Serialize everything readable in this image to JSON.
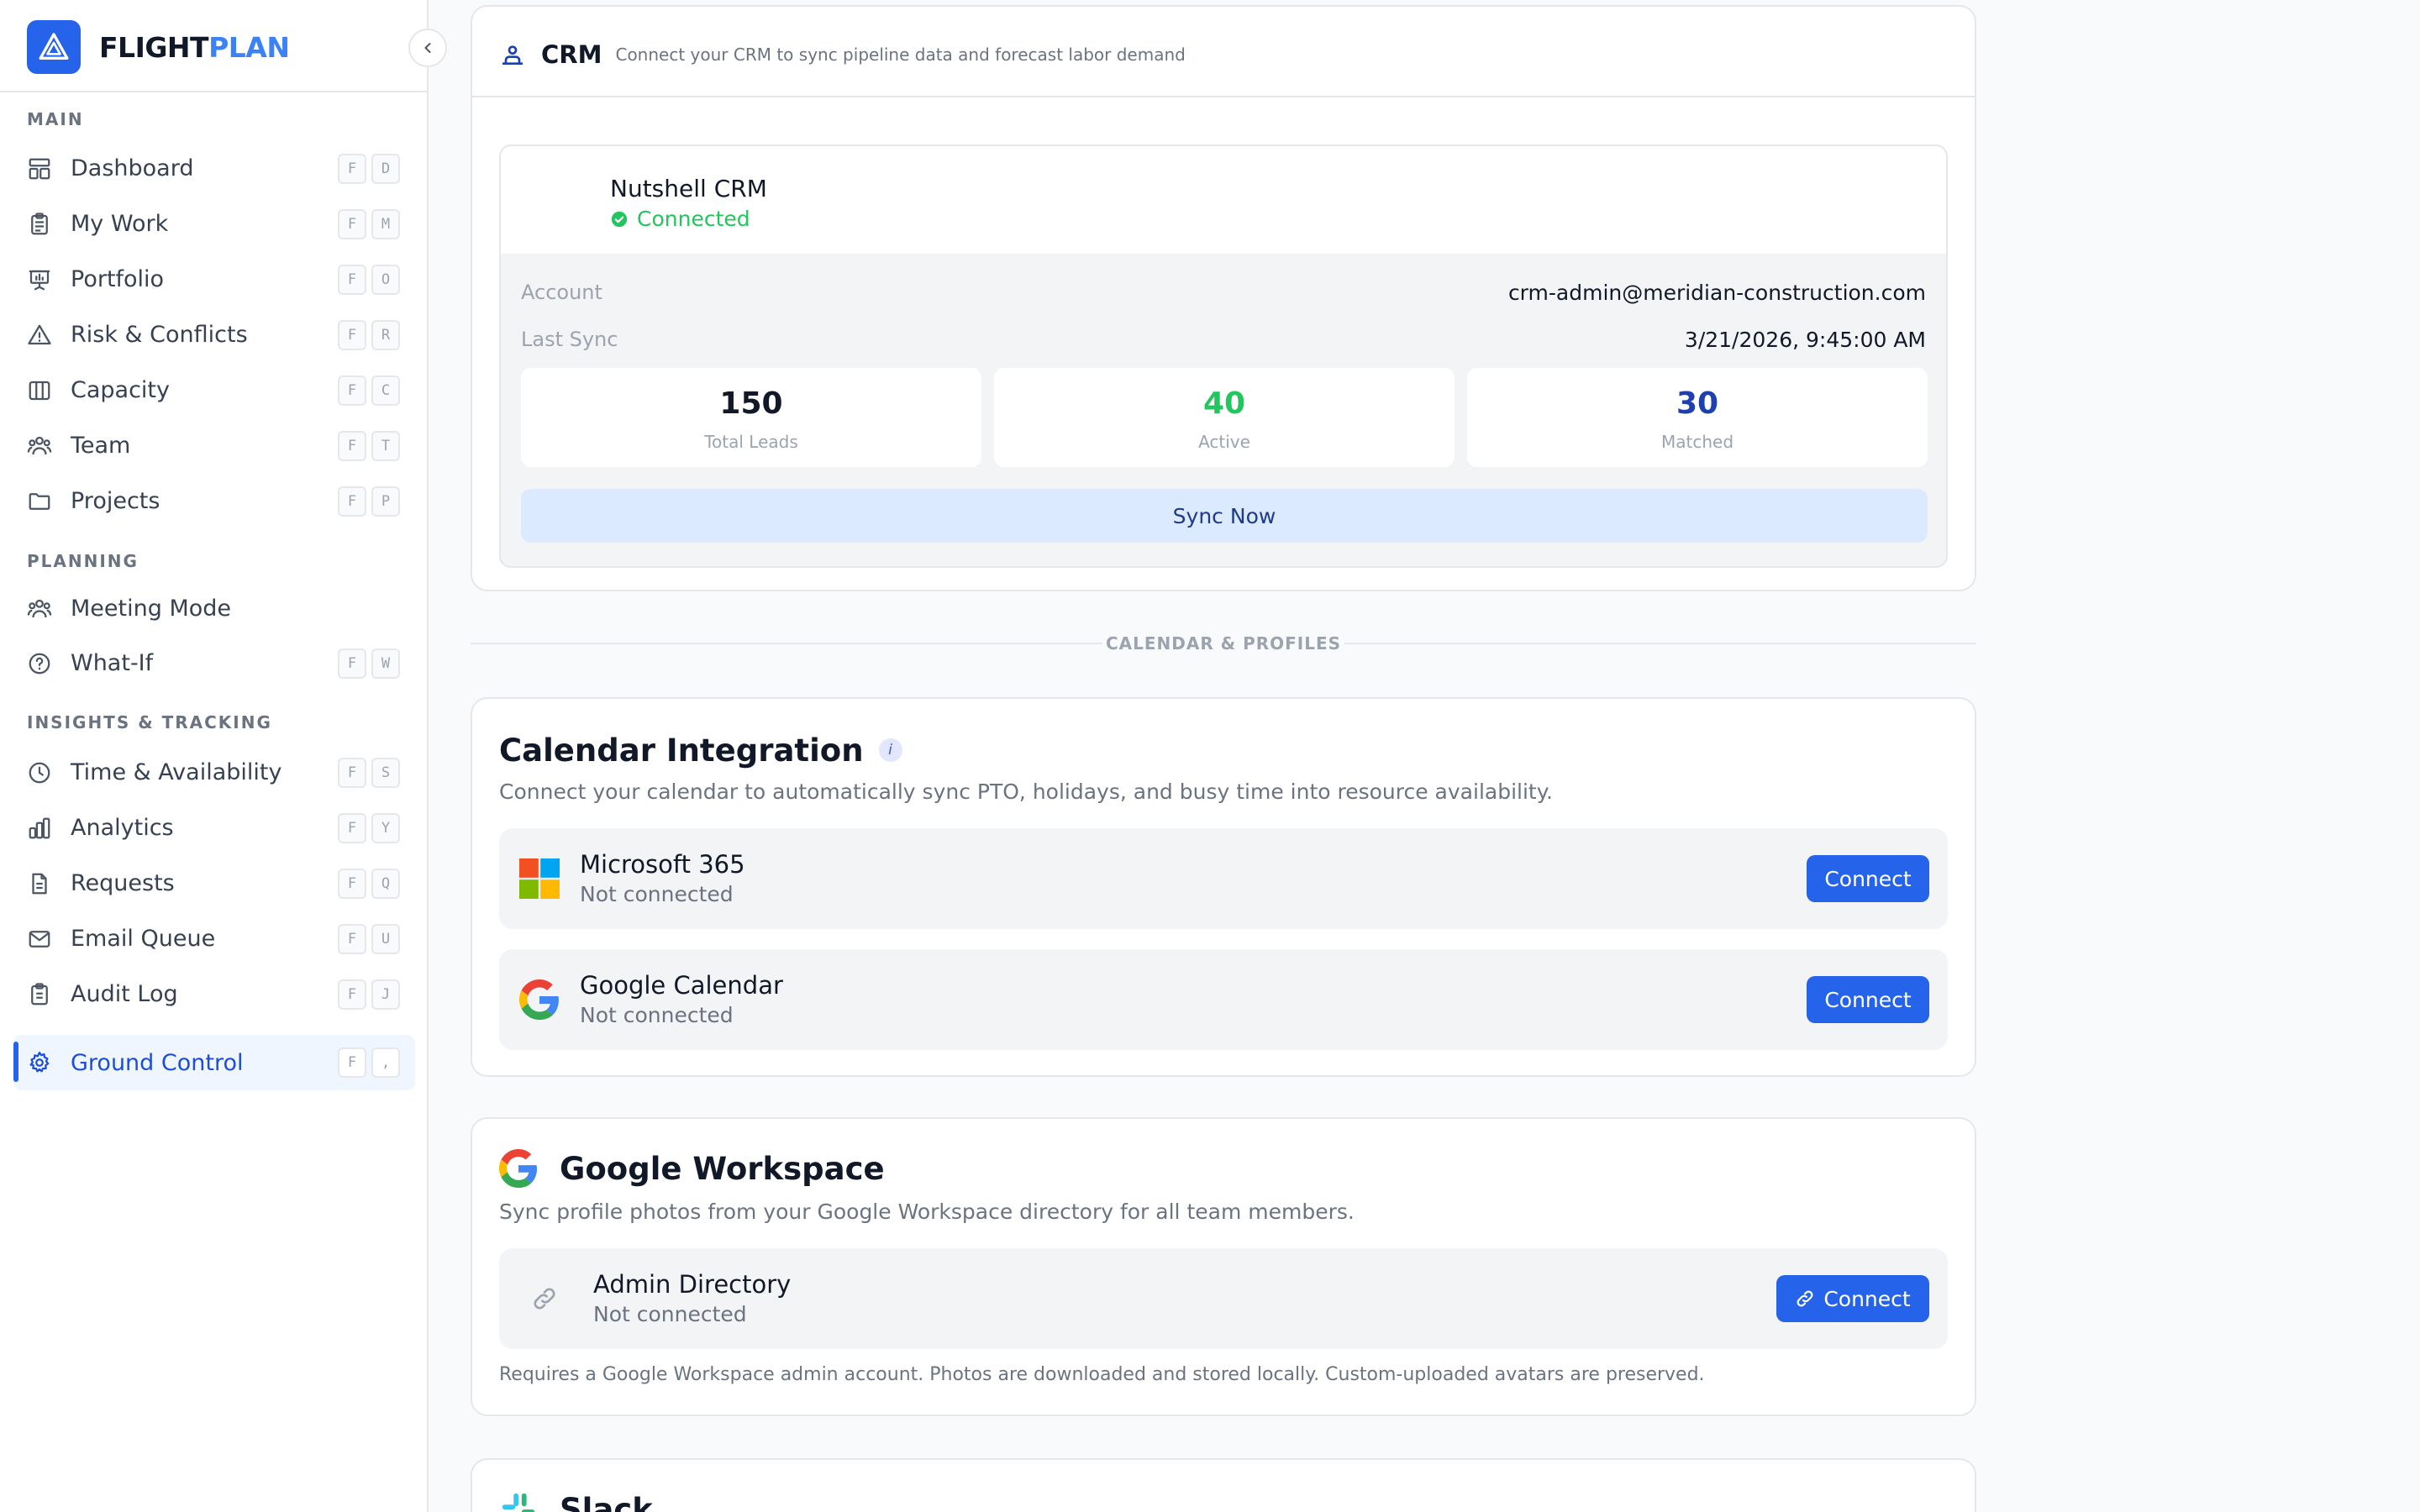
{
  "brand": {
    "part1": "FLIGHT",
    "part2": "PLAN"
  },
  "nav": {
    "main_label": "MAIN",
    "planning_label": "PLANNING",
    "insights_label": "INSIGHTS & TRACKING",
    "items": [
      {
        "label": "Dashboard",
        "k1": "F",
        "k2": "D"
      },
      {
        "label": "My Work",
        "k1": "F",
        "k2": "M"
      },
      {
        "label": "Portfolio",
        "k1": "F",
        "k2": "O"
      },
      {
        "label": "Risk & Conflicts",
        "k1": "F",
        "k2": "R"
      },
      {
        "label": "Capacity",
        "k1": "F",
        "k2": "C"
      },
      {
        "label": "Team",
        "k1": "F",
        "k2": "T"
      },
      {
        "label": "Projects",
        "k1": "F",
        "k2": "P"
      },
      {
        "label": "Meeting Mode"
      },
      {
        "label": "What-If",
        "k1": "F",
        "k2": "W"
      },
      {
        "label": "Time & Availability",
        "k1": "F",
        "k2": "S"
      },
      {
        "label": "Analytics",
        "k1": "F",
        "k2": "Y"
      },
      {
        "label": "Requests",
        "k1": "F",
        "k2": "Q"
      },
      {
        "label": "Email Queue",
        "k1": "F",
        "k2": "U"
      },
      {
        "label": "Audit Log",
        "k1": "F",
        "k2": "J"
      },
      {
        "label": "Ground Control",
        "k1": "F",
        "k2": ","
      }
    ]
  },
  "crm": {
    "title": "CRM",
    "subtitle": "Connect your CRM to sync pipeline data and forecast labor demand",
    "provider": "Nutshell CRM",
    "status": "Connected",
    "account_label": "Account",
    "account_value": "crm-admin@meridian-construction.com",
    "last_sync_label": "Last Sync",
    "last_sync_value": "3/21/2026, 9:45:00 AM",
    "stats": [
      {
        "value": "150",
        "label": "Total Leads",
        "color": "#111827"
      },
      {
        "value": "40",
        "label": "Active",
        "color": "#22c55e"
      },
      {
        "value": "30",
        "label": "Matched",
        "color": "#1e40af"
      }
    ],
    "sync_button": "Sync Now"
  },
  "divider_label": "CALENDAR & PROFILES",
  "calendar": {
    "title": "Calendar Integration",
    "info_glyph": "i",
    "description": "Connect your calendar to automatically sync PTO, holidays, and busy time into resource availability.",
    "providers": [
      {
        "name": "Microsoft 365",
        "status": "Not connected",
        "button": "Connect"
      },
      {
        "name": "Google Calendar",
        "status": "Not connected",
        "button": "Connect"
      }
    ]
  },
  "workspace": {
    "title": "Google Workspace",
    "description": "Sync profile photos from your Google Workspace directory for all team members.",
    "directory": {
      "name": "Admin Directory",
      "status": "Not connected",
      "button": "Connect"
    },
    "note": "Requires a Google Workspace admin account. Photos are downloaded and stored locally. Custom-uploaded avatars are preserved."
  },
  "slack": {
    "title": "Slack"
  },
  "colors": {
    "accent": "#2563eb",
    "success": "#22c55e",
    "brand_blue": "#3b82f6"
  }
}
